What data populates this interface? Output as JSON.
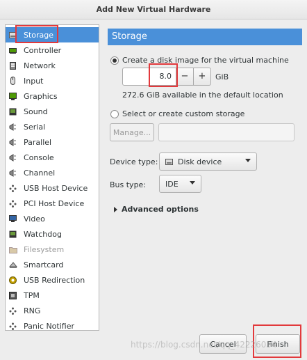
{
  "window": {
    "title": "Add New Virtual Hardware"
  },
  "sidebar": {
    "items": [
      {
        "label": "Storage",
        "icon": "storage-icon"
      },
      {
        "label": "Controller",
        "icon": "controller-icon"
      },
      {
        "label": "Network",
        "icon": "network-icon"
      },
      {
        "label": "Input",
        "icon": "mouse-icon"
      },
      {
        "label": "Graphics",
        "icon": "graphics-icon"
      },
      {
        "label": "Sound",
        "icon": "sound-icon"
      },
      {
        "label": "Serial",
        "icon": "serial-icon"
      },
      {
        "label": "Parallel",
        "icon": "parallel-icon"
      },
      {
        "label": "Console",
        "icon": "console-icon"
      },
      {
        "label": "Channel",
        "icon": "channel-icon"
      },
      {
        "label": "USB Host Device",
        "icon": "usb-icon"
      },
      {
        "label": "PCI Host Device",
        "icon": "pci-icon"
      },
      {
        "label": "Video",
        "icon": "video-icon"
      },
      {
        "label": "Watchdog",
        "icon": "watchdog-icon"
      },
      {
        "label": "Filesystem",
        "icon": "folder-icon"
      },
      {
        "label": "Smartcard",
        "icon": "smartcard-icon"
      },
      {
        "label": "USB Redirection",
        "icon": "usb-redirection-icon"
      },
      {
        "label": "TPM",
        "icon": "tpm-icon"
      },
      {
        "label": "RNG",
        "icon": "rng-icon"
      },
      {
        "label": "Panic Notifier",
        "icon": "panic-icon"
      }
    ]
  },
  "storage": {
    "header": "Storage",
    "create_option_label": "Create a disk image for the virtual machine",
    "size_value": "8.0",
    "size_unit": "GiB",
    "available_text": "272.6 GiB available in the default location",
    "custom_option_label": "Select or create custom storage",
    "manage_label": "Manage...",
    "device_type_label": "Device type:",
    "device_type_value": "Disk device",
    "bus_type_label": "Bus type:",
    "bus_type_value": "IDE",
    "advanced_label": "Advanced options"
  },
  "footer": {
    "cancel_label": "Cancel",
    "finish_label": "Finish"
  },
  "watermark": "https://blog.csdn.net/qq_42226034",
  "colors": {
    "accent": "#4a90d9",
    "highlight": "#e2393c"
  }
}
